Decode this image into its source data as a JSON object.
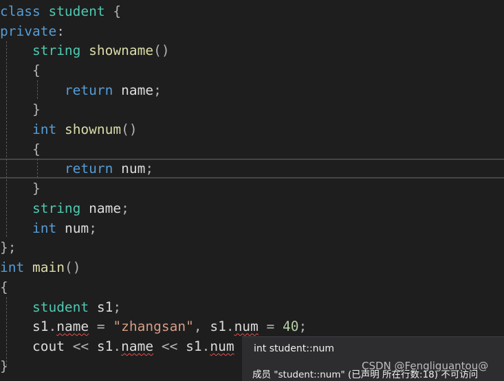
{
  "code": {
    "l1": [
      "class",
      "student",
      "{"
    ],
    "l2": [
      "private",
      ":"
    ],
    "l3": [
      "string",
      "showname",
      "()"
    ],
    "l4": [
      "{"
    ],
    "l5": [
      "return",
      "name",
      ";"
    ],
    "l6": [
      "}"
    ],
    "l7": [
      "int",
      "shownum",
      "()"
    ],
    "l8": [
      "{"
    ],
    "l9": [
      "return",
      "num",
      ";"
    ],
    "l10": [
      "}"
    ],
    "l11": [
      "string",
      "name",
      ";"
    ],
    "l12": [
      "int",
      "num",
      ";"
    ],
    "l13": [
      "}",
      ";"
    ],
    "l14": [
      "int",
      "main",
      "()"
    ],
    "l15": [
      "{"
    ],
    "l16": [
      "student",
      "s1",
      ";"
    ],
    "l17": [
      "s1",
      ".",
      "name",
      "=",
      "\"zhangsan\"",
      ",",
      "s1",
      ".",
      "num",
      "=",
      "40",
      ";"
    ],
    "l18": [
      "cout",
      "<<",
      "s1",
      ".",
      "name",
      "<<",
      "s1",
      ".",
      "num"
    ],
    "l19": [
      "}"
    ]
  },
  "tooltip": {
    "signature": "int student::num",
    "message": "成员 \"student::num\" (已声明 所在行数:18) 不可访问"
  },
  "watermark": "CSDN @Fengliguantou@",
  "colors": {
    "background": "#1e1e1e",
    "keyword": "#569cd6",
    "type": "#4ec9b0",
    "function": "#dcdcaa",
    "identifier": "#dcdcdc",
    "string": "#d69d85",
    "number": "#b5cea8",
    "error_squiggle": "#f14c4c",
    "tooltip_background": "#2d2d30"
  }
}
